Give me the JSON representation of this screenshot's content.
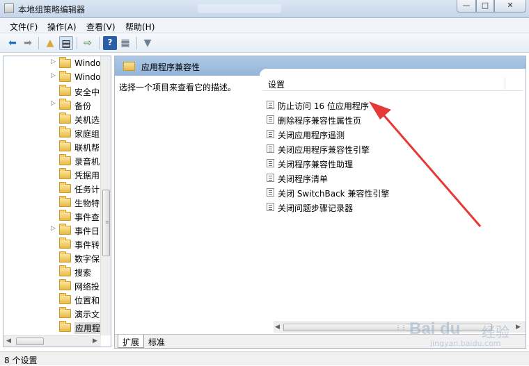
{
  "window": {
    "title": "本地组策略编辑器",
    "controls": {
      "minimize": "—",
      "maximize": "□",
      "close": "✕"
    }
  },
  "menu": [
    "文件(F)",
    "操作(A)",
    "查看(V)",
    "帮助(H)"
  ],
  "toolbar": {
    "icons": [
      "back-arrow-icon",
      "forward-arrow-icon",
      "folder-up-icon",
      "show-hide-tree-icon",
      "export-list-icon",
      "help-icon",
      "properties-icon",
      "filter-icon"
    ]
  },
  "tree": {
    "items": [
      {
        "label": "Windo",
        "expandable": true
      },
      {
        "label": "Windo",
        "expandable": true
      },
      {
        "label": "安全中",
        "expandable": false
      },
      {
        "label": "备份",
        "expandable": true
      },
      {
        "label": "关机选",
        "expandable": false
      },
      {
        "label": "家庭组",
        "expandable": false
      },
      {
        "label": "联机帮",
        "expandable": false
      },
      {
        "label": "录音机",
        "expandable": false
      },
      {
        "label": "凭据用",
        "expandable": false
      },
      {
        "label": "任务计",
        "expandable": false
      },
      {
        "label": "生物特",
        "expandable": false
      },
      {
        "label": "事件查",
        "expandable": false
      },
      {
        "label": "事件日",
        "expandable": true
      },
      {
        "label": "事件转",
        "expandable": false
      },
      {
        "label": "数字保",
        "expandable": false
      },
      {
        "label": "搜索",
        "expandable": false
      },
      {
        "label": "网络投",
        "expandable": false
      },
      {
        "label": "位置和",
        "expandable": false
      },
      {
        "label": "演示文",
        "expandable": false
      },
      {
        "label": "应用程",
        "expandable": false,
        "selected": true
      }
    ]
  },
  "content": {
    "header_title": "应用程序兼容性",
    "description": "选择一个项目来查看它的描述。",
    "column_header": "设置",
    "settings": [
      "防止访问 16 位应用程序",
      "删除程序兼容性属性页",
      "关闭应用程序遥测",
      "关闭应用程序兼容性引擎",
      "关闭程序兼容性助理",
      "关闭程序清单",
      "关闭 SwitchBack 兼容性引擎",
      "关闭问题步骤记录器"
    ]
  },
  "tabs": [
    "扩展",
    "标准"
  ],
  "status": "8 个设置",
  "watermark": {
    "brand": "Bai",
    "paw": "du",
    "cn": "经验",
    "url": "jingyan.baidu.com"
  },
  "annotation": {
    "color": "#e53935"
  }
}
